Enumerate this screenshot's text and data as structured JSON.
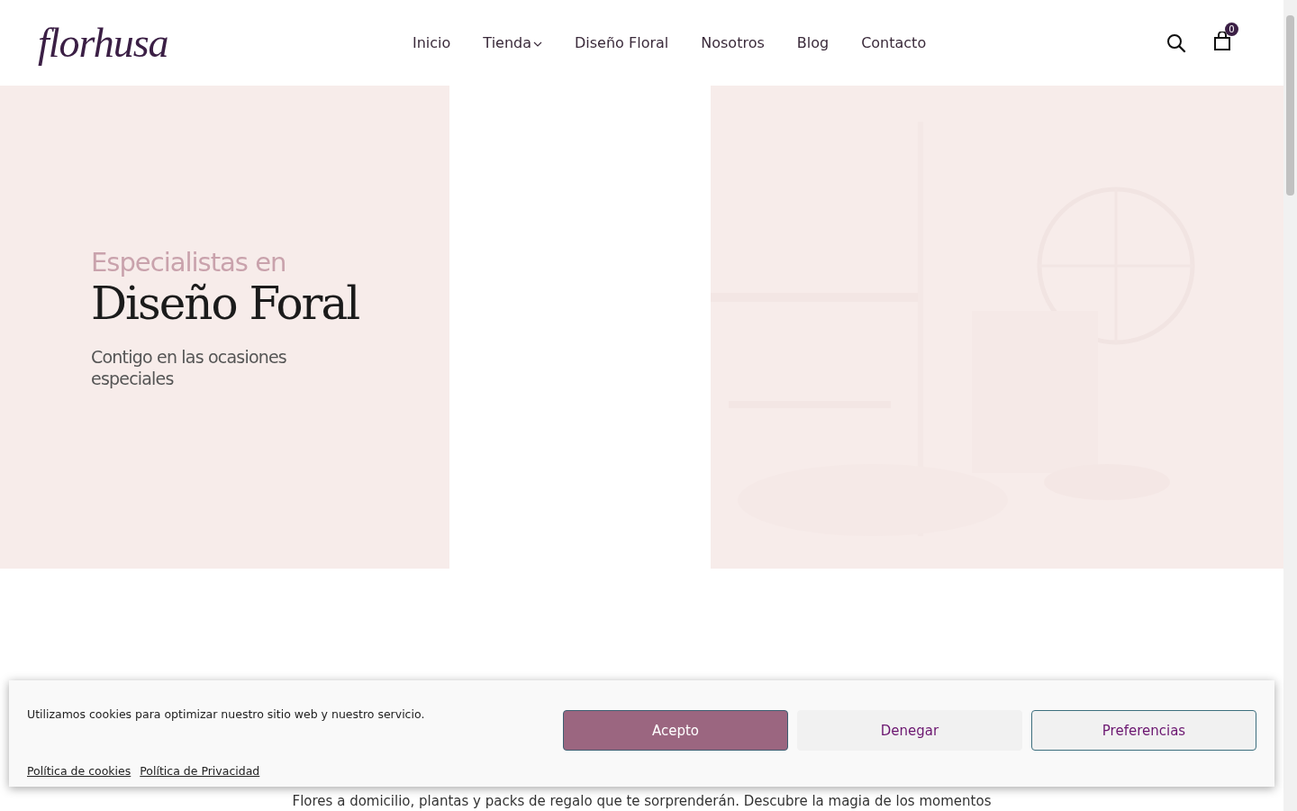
{
  "header": {
    "logo": "florhusa",
    "nav": [
      {
        "label": "Inicio",
        "dropdown": false
      },
      {
        "label": "Tienda",
        "dropdown": true
      },
      {
        "label": "Diseño Floral",
        "dropdown": false
      },
      {
        "label": "Nosotros",
        "dropdown": false
      },
      {
        "label": "Blog",
        "dropdown": false
      },
      {
        "label": "Contacto",
        "dropdown": false
      }
    ],
    "cart_count": "0"
  },
  "hero": {
    "kicker": "Especialistas en",
    "title": "Diseño Foral",
    "subtitle": "Contigo en las ocasiones especiales"
  },
  "intro": {
    "text": "Flores a domicilio, plantas y packs de regalo que te sorprenderán. Descubre la magia de los momentos"
  },
  "cookie_banner": {
    "message": "Utilizamos cookies para optimizar nuestro sitio web y nuestro servicio.",
    "links": [
      "Política de cookies",
      "Política de Privacidad"
    ],
    "buttons": [
      {
        "label": "Acepto",
        "kind": "primary"
      },
      {
        "label": "Denegar",
        "kind": "plain"
      },
      {
        "label": "Preferencias",
        "kind": "outline"
      }
    ]
  }
}
